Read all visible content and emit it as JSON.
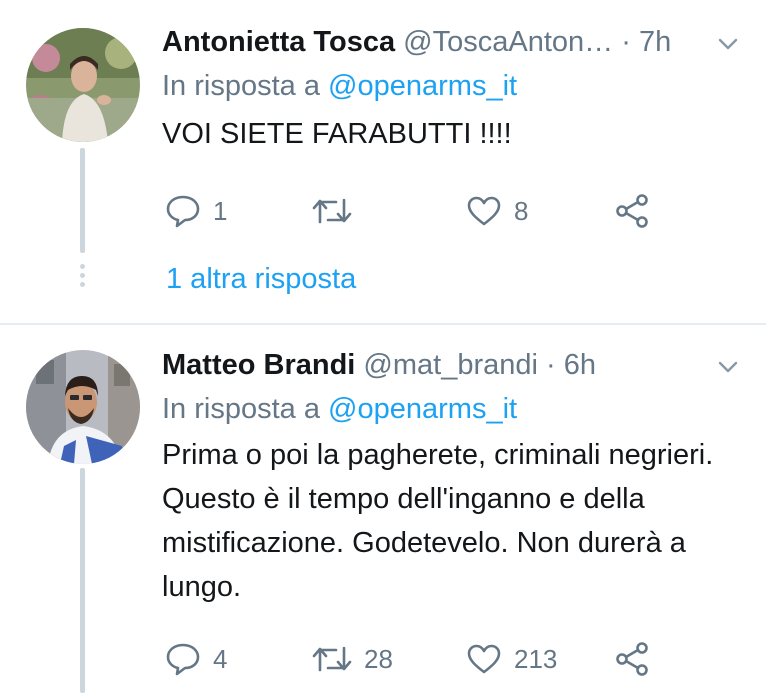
{
  "tweets": [
    {
      "name": "Antonietta Tosca",
      "handle": "@ToscaAnton…",
      "separator": "·",
      "time": "7h",
      "reply_prefix": "In risposta a",
      "reply_to": "@openarms_it",
      "text": "VOI SIETE FARABUTTI !!!!",
      "replies": "1",
      "retweets": "",
      "likes": "8",
      "more_replies": "1 altra risposta"
    },
    {
      "name": "Matteo Brandi",
      "handle": "@mat_brandi",
      "separator": "·",
      "time": "6h",
      "reply_prefix": "In risposta a",
      "reply_to": "@openarms_it",
      "text": "Prima o poi la pagherete, criminali negrieri. Questo è il tempo dell'inganno e della mistificazione. Godetevelo. Non durerà a lungo.",
      "replies": "4",
      "retweets": "28",
      "likes": "213"
    }
  ],
  "icons": {
    "reply": "reply-icon",
    "retweet": "retweet-icon",
    "like": "heart-icon",
    "share": "share-icon",
    "caret": "chevron-down-icon"
  },
  "colors": {
    "link": "#1da1f2",
    "secondary_text": "#657786",
    "primary_text": "#14171a",
    "thread_line": "#ccd6dd",
    "divider": "#e6ecf0"
  }
}
